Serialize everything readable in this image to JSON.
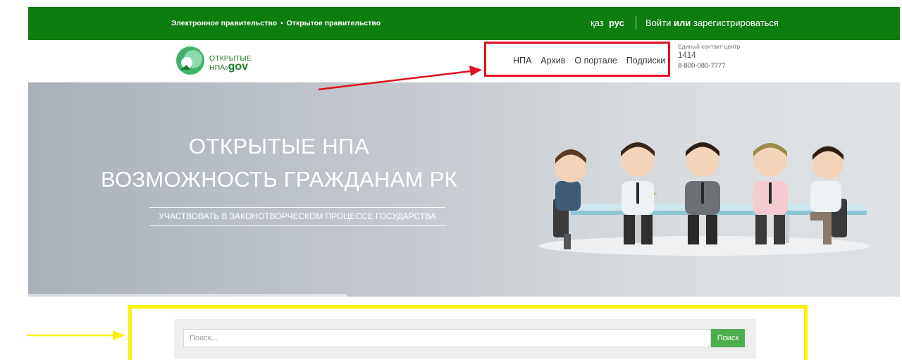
{
  "topbar": {
    "egov_link": "Электронное правительство",
    "dot": "•",
    "opengov_link": "Открытое правительство",
    "lang_kaz": "қаз",
    "lang_rus": "рус",
    "login": "Войти",
    "or": "или",
    "register": "зарегистрироваться"
  },
  "header": {
    "logo_line1": "ОТКРЫТЫЕ",
    "logo_line2_prefix": "НПА",
    "logo_line2_e": "e",
    "logo_line2_gov": "gov",
    "nav": [
      "НПА",
      "Архив",
      "О портале",
      "Подписки"
    ],
    "contact_label": "Единый контакт-центр",
    "contact_number": "1414",
    "contact_phone": "8-800-080-7777"
  },
  "hero": {
    "title_line1": "ОТКРЫТЫЕ НПА",
    "title_line2": "ВОЗМОЖНОСТЬ ГРАЖДАНАМ РК",
    "subtitle": "УЧАСТВОВАТЬ В ЗАКОНОТВОРЧЕСКОМ ПРОЦЕССЕ ГОСУДАРСТВА"
  },
  "search": {
    "placeholder": "Поиск...",
    "button": "Поиск"
  },
  "colors": {
    "topbar_green": "#0d7d0d",
    "button_green": "#4cae4c",
    "annotation_red": "#e01020",
    "annotation_yellow": "#f6f20a"
  }
}
